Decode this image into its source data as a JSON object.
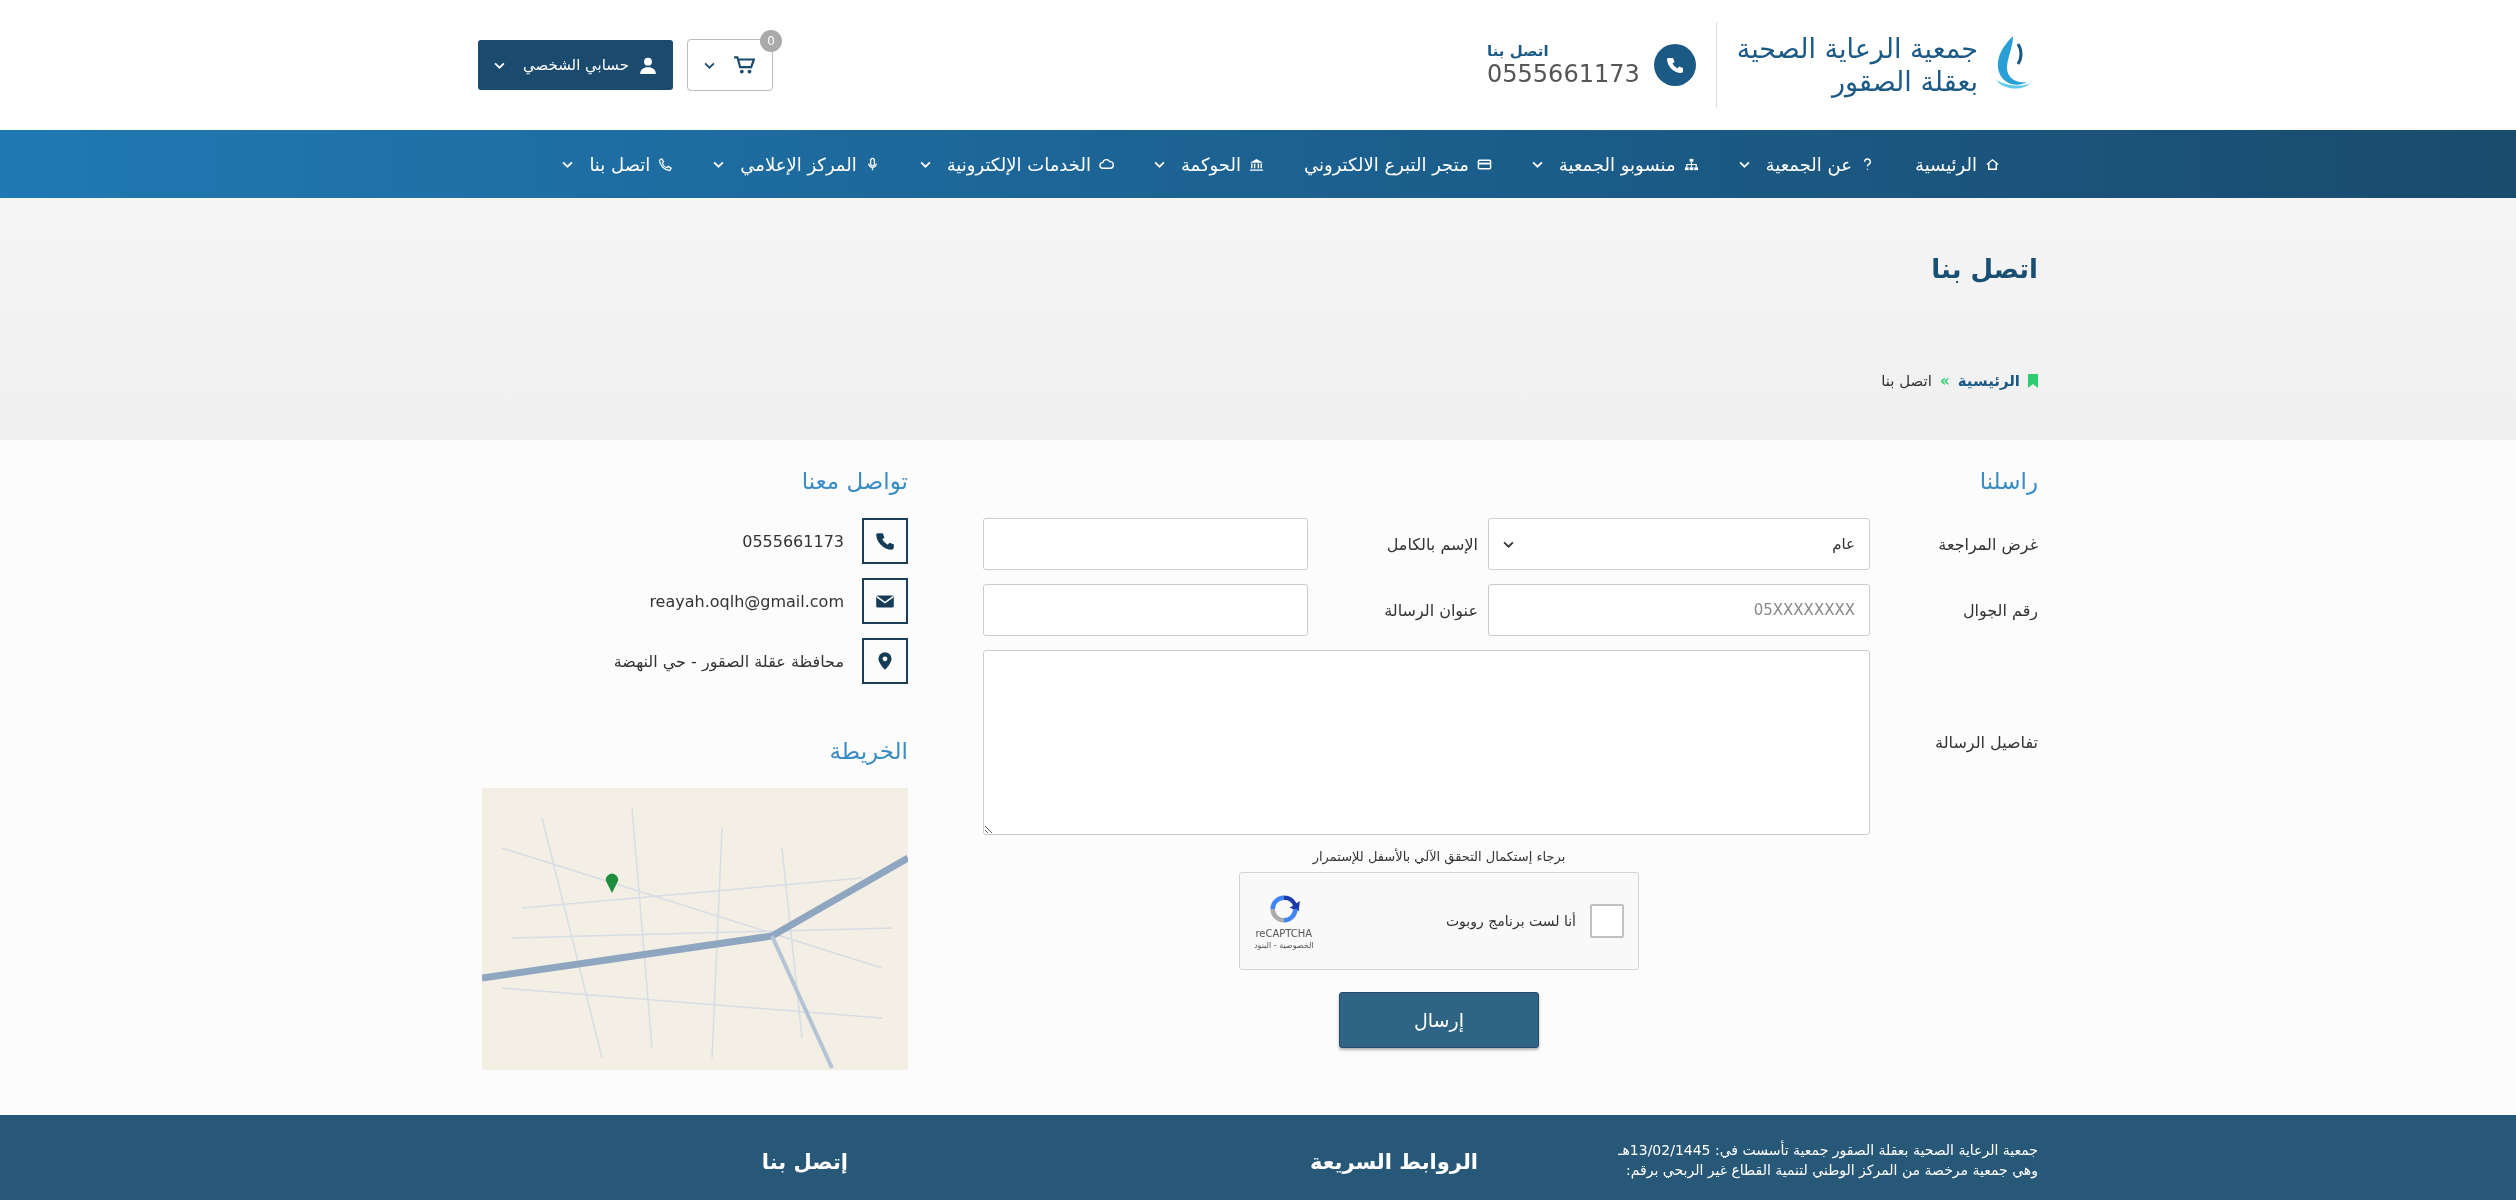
{
  "header": {
    "org_name_line1": "جمعية الرعاية الصحية",
    "org_name_line2": "بعقلة الصقور",
    "contact_label": "اتصل بنا",
    "contact_phone": "0555661173",
    "cart_count": "0",
    "account_label": "حسابي الشخصي"
  },
  "nav": [
    {
      "label": "الرئيسية",
      "has_menu": false
    },
    {
      "label": "عن الجمعية",
      "has_menu": true
    },
    {
      "label": "منسوبو الجمعية",
      "has_menu": true
    },
    {
      "label": "متجر التبرع الالكتروني",
      "has_menu": false
    },
    {
      "label": "الحوكمة",
      "has_menu": true
    },
    {
      "label": "الخدمات الإلكترونية",
      "has_menu": true
    },
    {
      "label": "المركز الإعلامي",
      "has_menu": true
    },
    {
      "label": "اتصل بنا",
      "has_menu": true
    }
  ],
  "page_title": "اتصل بنا",
  "breadcrumb": {
    "home": "الرئيسية",
    "separator": "»",
    "current": "اتصل بنا"
  },
  "form": {
    "title": "راسلنا",
    "fields": [
      {
        "label": "غرض المراجعة",
        "kind": "select",
        "value": "عام"
      },
      {
        "label": "الإسم بالكامل",
        "kind": "text"
      },
      {
        "label": "رقم الجوال",
        "kind": "text",
        "placeholder": "05XXXXXXXX"
      },
      {
        "label": "عنوان الرسالة",
        "kind": "text"
      },
      {
        "label": "تفاصيل الرسالة",
        "kind": "textarea"
      }
    ],
    "captcha_hint": "برجاء إستكمال التحقق الآلي بالأسفل للإستمرار",
    "captcha": {
      "label": "أنا لست برنامج روبوت",
      "checked": false,
      "brand": "reCAPTCHA",
      "links": "الخصوصية - البنود"
    },
    "submit": "إرسال"
  },
  "contact": {
    "title": "تواصل معنا",
    "items": [
      {
        "kind": "phone",
        "text": "0555661173"
      },
      {
        "kind": "email",
        "text": "reayah.oqlh@gmail.com"
      },
      {
        "kind": "address",
        "text": "محافظة عقلة الصقور - حي النهضة"
      }
    ],
    "map_title": "الخريطة"
  },
  "footer": {
    "about": [
      "جمعية الرعاية الصحية بعقلة الصقور جمعية تأسست في: 13/02/1445هـ",
      "وهي جمعية مرخصة من المركز الوطني لتنمية القطاع غير الربحي برقم:"
    ],
    "quick_links_title": "الروابط السريعة",
    "contact_title": "إتصل بنا"
  }
}
